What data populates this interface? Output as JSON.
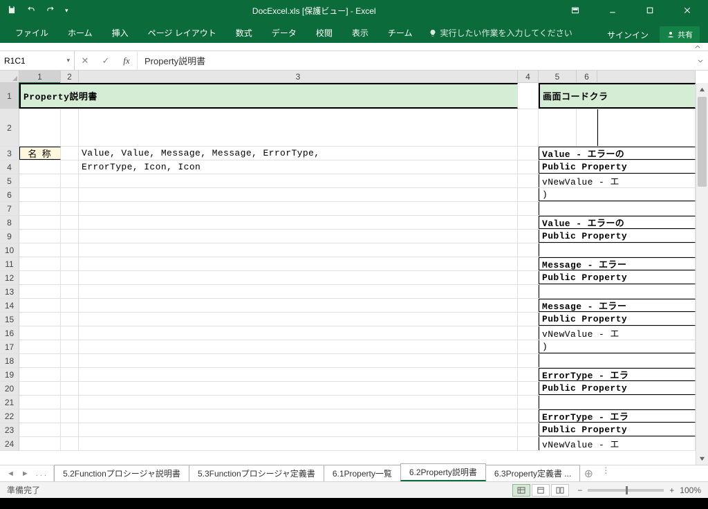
{
  "window": {
    "title": "DocExcel.xls  [保護ビュー]  -  Excel"
  },
  "ribbon": {
    "tabs": [
      "ファイル",
      "ホーム",
      "挿入",
      "ページ レイアウト",
      "数式",
      "データ",
      "校閲",
      "表示",
      "チーム"
    ],
    "tell_placeholder": "実行したい作業を入力してください",
    "signin": "サインイン",
    "share": "共有"
  },
  "namebox": "R1C1",
  "formula": "Property説明書",
  "columns": [
    "1",
    "2",
    "3",
    "4",
    "5",
    "6"
  ],
  "rows": [
    "1",
    "2",
    "3",
    "4",
    "5",
    "6",
    "7",
    "8",
    "9",
    "10",
    "11",
    "12",
    "13",
    "14",
    "15",
    "16",
    "17",
    "18",
    "19",
    "20",
    "21",
    "22",
    "23",
    "24"
  ],
  "content": {
    "title_left": "Property説明書",
    "title_right": "画面コードクラ",
    "label_name": "名 称",
    "line3": "Value, Value, Message, Message, ErrorType,",
    "line4": "ErrorType, Icon, Icon",
    "side": {
      "r3": "Value - エラーの",
      "r4": "Public Property",
      "r5": " vNewValue  - エ",
      "r6": ")",
      "r8": "Value - エラーの",
      "r9": "Public Property",
      "r11": "Message - エラー",
      "r12": "Public Property",
      "r14": "Message - エラー",
      "r15": "Public Property",
      "r16": " vNewValue  - エ",
      "r17": ")",
      "r19": "ErrorType - エラ",
      "r20": "Public Property",
      "r22": "ErrorType - エラ",
      "r23": "Public Property",
      "r24": " vNewValue  - エ"
    }
  },
  "sheets": {
    "ellipsis": ". . .",
    "tabs": [
      "5.2Functionプロシージャ説明書",
      "5.3Functionプロシージャ定義書",
      "6.1Property一覧",
      "6.2Property説明書",
      "6.3Property定義書 ..."
    ],
    "active": 3
  },
  "status": {
    "ready": "準備完了",
    "zoom": "100%"
  }
}
